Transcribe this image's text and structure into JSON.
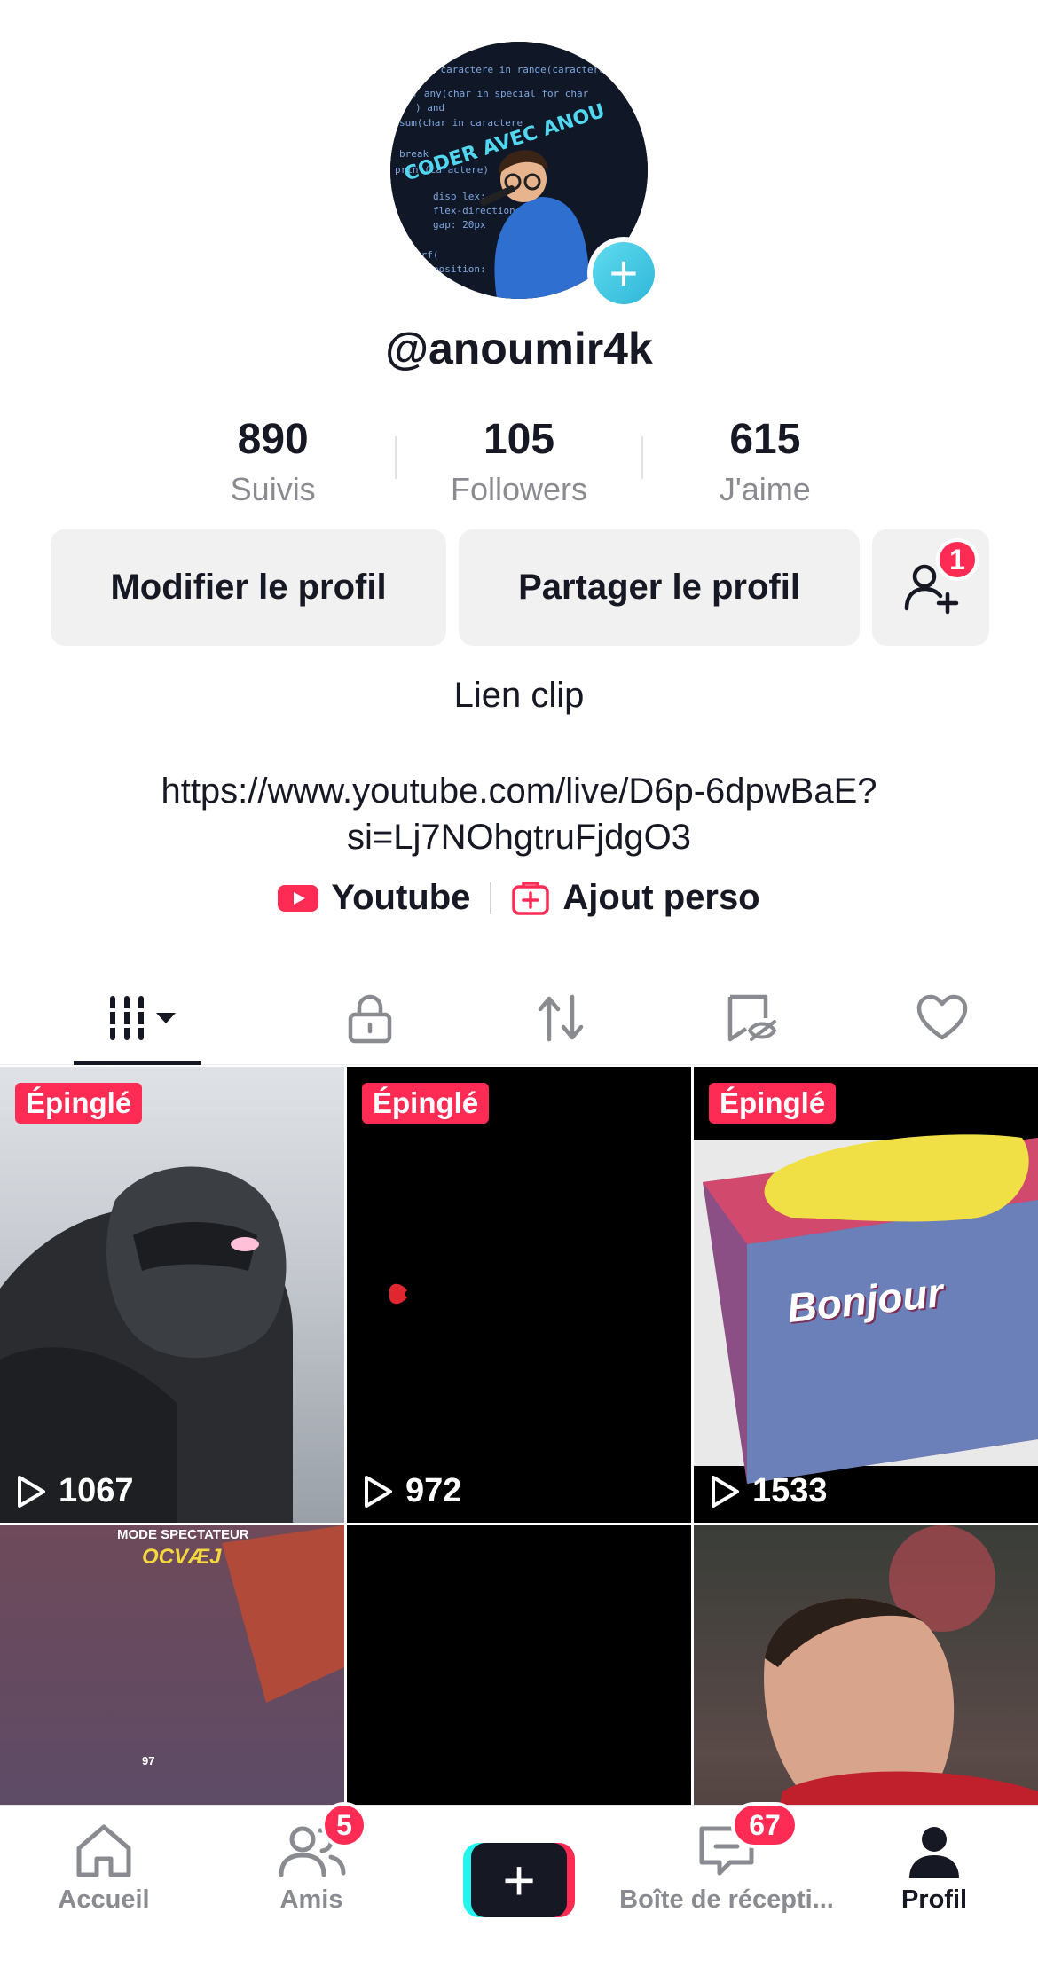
{
  "profile": {
    "username": "@anoumir4k",
    "avatar_text": "CODER AVEC ANOU"
  },
  "stats": [
    {
      "value": "890",
      "label": "Suivis"
    },
    {
      "value": "105",
      "label": "Followers"
    },
    {
      "value": "615",
      "label": "J'aime"
    }
  ],
  "actions": {
    "edit_label": "Modifier le profil",
    "share_label": "Partager le profil",
    "friend_badge": "1"
  },
  "bio": {
    "title": "Lien clip",
    "link_line1": "https://www.youtube.com/live/D6p-6dpwBaE?",
    "link_line2": "si=Lj7NOhgtruFjdgO3"
  },
  "links": {
    "youtube": "Youtube",
    "custom": "Ajout perso"
  },
  "tabs": [
    "videos-grid-icon",
    "lock-icon",
    "repost-icon",
    "hidden-icon",
    "heart-icon"
  ],
  "videos": [
    {
      "pinned": "Épinglé",
      "views": "1067"
    },
    {
      "pinned": "Épinglé",
      "views": "972"
    },
    {
      "pinned": "Épinglé",
      "views": "1533",
      "overlay": "Bonjour"
    },
    {
      "caption": "MODE SPECTATEUR",
      "subcaption": "OCVÆJ",
      "score": "97"
    },
    {},
    {}
  ],
  "nav": {
    "home": "Accueil",
    "friends": "Amis",
    "friends_badge": "5",
    "inbox": "Boîte de récepti...",
    "inbox_badge": "67",
    "profile": "Profil"
  },
  "colors": {
    "accent": "#fe2c55",
    "cyan": "#25f4ee",
    "text": "#161823",
    "muted": "#8a8b91",
    "button_bg": "#f1f1f2"
  }
}
